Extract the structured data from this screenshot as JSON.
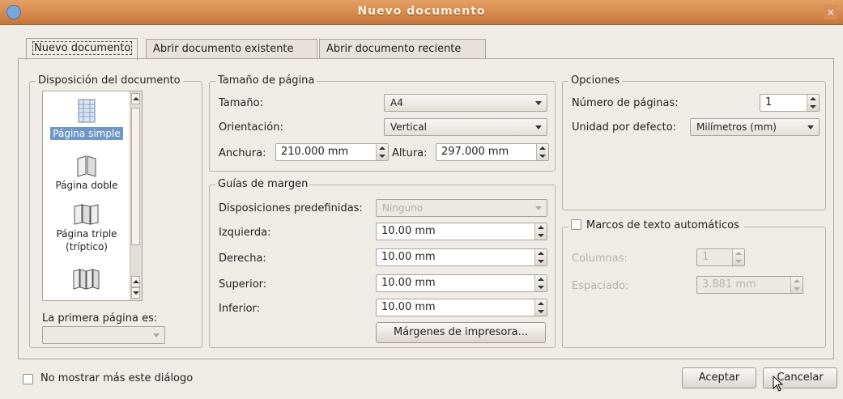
{
  "window": {
    "title": "Nuevo documento",
    "close_glyph": "×"
  },
  "tabs": [
    {
      "label": "Nuevo documento"
    },
    {
      "label": "Abrir documento existente"
    },
    {
      "label": "Abrir documento reciente"
    }
  ],
  "layout_group": {
    "title": "Disposición del documento",
    "items": [
      {
        "label": "Página simple",
        "icon": "single-page-icon",
        "selected": true
      },
      {
        "label": "Página doble",
        "icon": "double-page-icon"
      },
      {
        "label": "Página triple",
        "label2": "(tríptico)",
        "icon": "triple-page-icon"
      },
      {
        "label": "",
        "icon": "quad-page-icon"
      }
    ],
    "first_page_label": "La primera página es:",
    "first_page_value": ""
  },
  "page_size": {
    "title": "Tamaño de página",
    "size_label": "Tamaño:",
    "size_value": "A4",
    "orientation_label": "Orientación:",
    "orientation_value": "Vertical",
    "width_label": "Anchura:",
    "width_value": "210.000 mm",
    "height_label": "Altura:",
    "height_value": "297.000 mm"
  },
  "margins": {
    "title": "Guías de margen",
    "preset_label": "Disposiciones predefinidas:",
    "preset_value": "Ninguno",
    "left_label": "Izquierda:",
    "left_value": "10.00 mm",
    "right_label": "Derecha:",
    "right_value": "10.00 mm",
    "top_label": "Superior:",
    "top_value": "10.00 mm",
    "bottom_label": "Inferior:",
    "bottom_value": "10.00 mm",
    "printer_button": "Márgenes de impresora..."
  },
  "options": {
    "title": "Opciones",
    "pages_label": "Número de páginas:",
    "pages_value": "1",
    "unit_label": "Unidad por defecto:",
    "unit_value": "Milímetros (mm)"
  },
  "auto_frames": {
    "label": "Marcos de texto automáticos",
    "columns_label": "Columnas:",
    "columns_value": "1",
    "gap_label": "Espaciado:",
    "gap_value": "3.881 mm"
  },
  "footer": {
    "dont_show_label": "No mostrar más este diálogo",
    "accept": "Aceptar",
    "cancel": "Cancelar"
  },
  "colors": {
    "titlebar": "#d98c55",
    "selection": "#6d98c9",
    "dialog_bg": "#efebe7"
  }
}
